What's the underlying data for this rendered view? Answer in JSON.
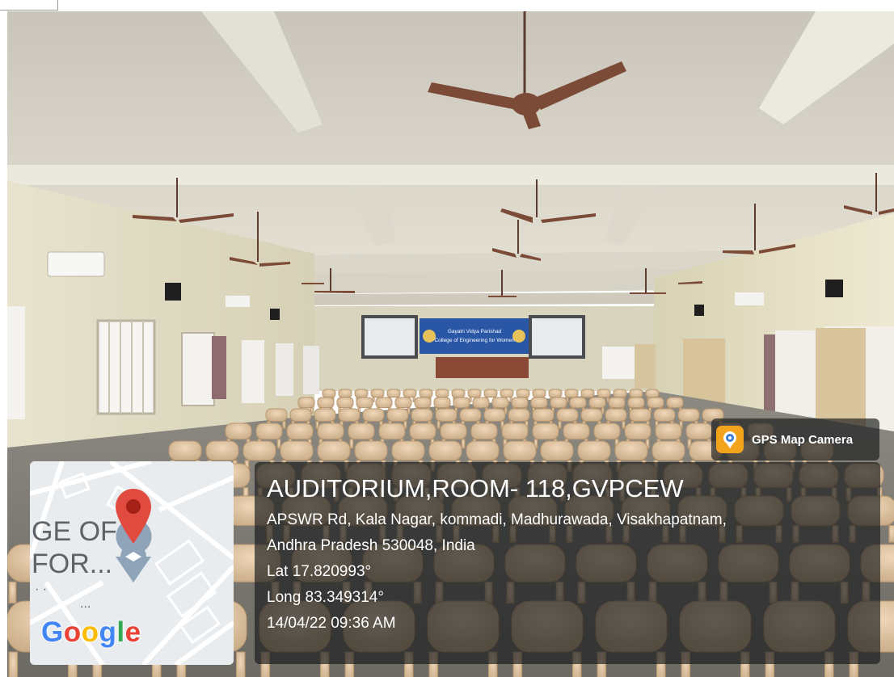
{
  "map": {
    "place_lines": [
      "GE OF",
      "FOR..."
    ],
    "dots": "· ·",
    "ellipsis": "...",
    "logo_letters": [
      {
        "char": "G",
        "color": "#4285F4"
      },
      {
        "char": "o",
        "color": "#EA4335"
      },
      {
        "char": "o",
        "color": "#FBBC05"
      },
      {
        "char": "g",
        "color": "#4285F4"
      },
      {
        "char": "l",
        "color": "#34A853"
      },
      {
        "char": "e",
        "color": "#EA4335"
      }
    ],
    "pin_color": "#e04a3f"
  },
  "badge": {
    "label": "GPS Map Camera",
    "icon": "map-pin-camera-icon",
    "icon_color": "#f3a41c"
  },
  "info": {
    "title": "AUDITORIUM,ROOM- 118,GVPCEW",
    "address_line_1": "APSWR Rd, Kala Nagar, kommadi, Madhurawada, Visakhapatnam,",
    "address_line_2": "Andhra Pradesh 530048, India",
    "latitude": "Lat 17.820993°",
    "longitude": "Long 83.349314°",
    "datetime": "14/04/22 09:36 AM"
  },
  "banner": {
    "line_1": "Gayatri Vidya Parishad",
    "line_2": "College of Engineering for Women"
  }
}
